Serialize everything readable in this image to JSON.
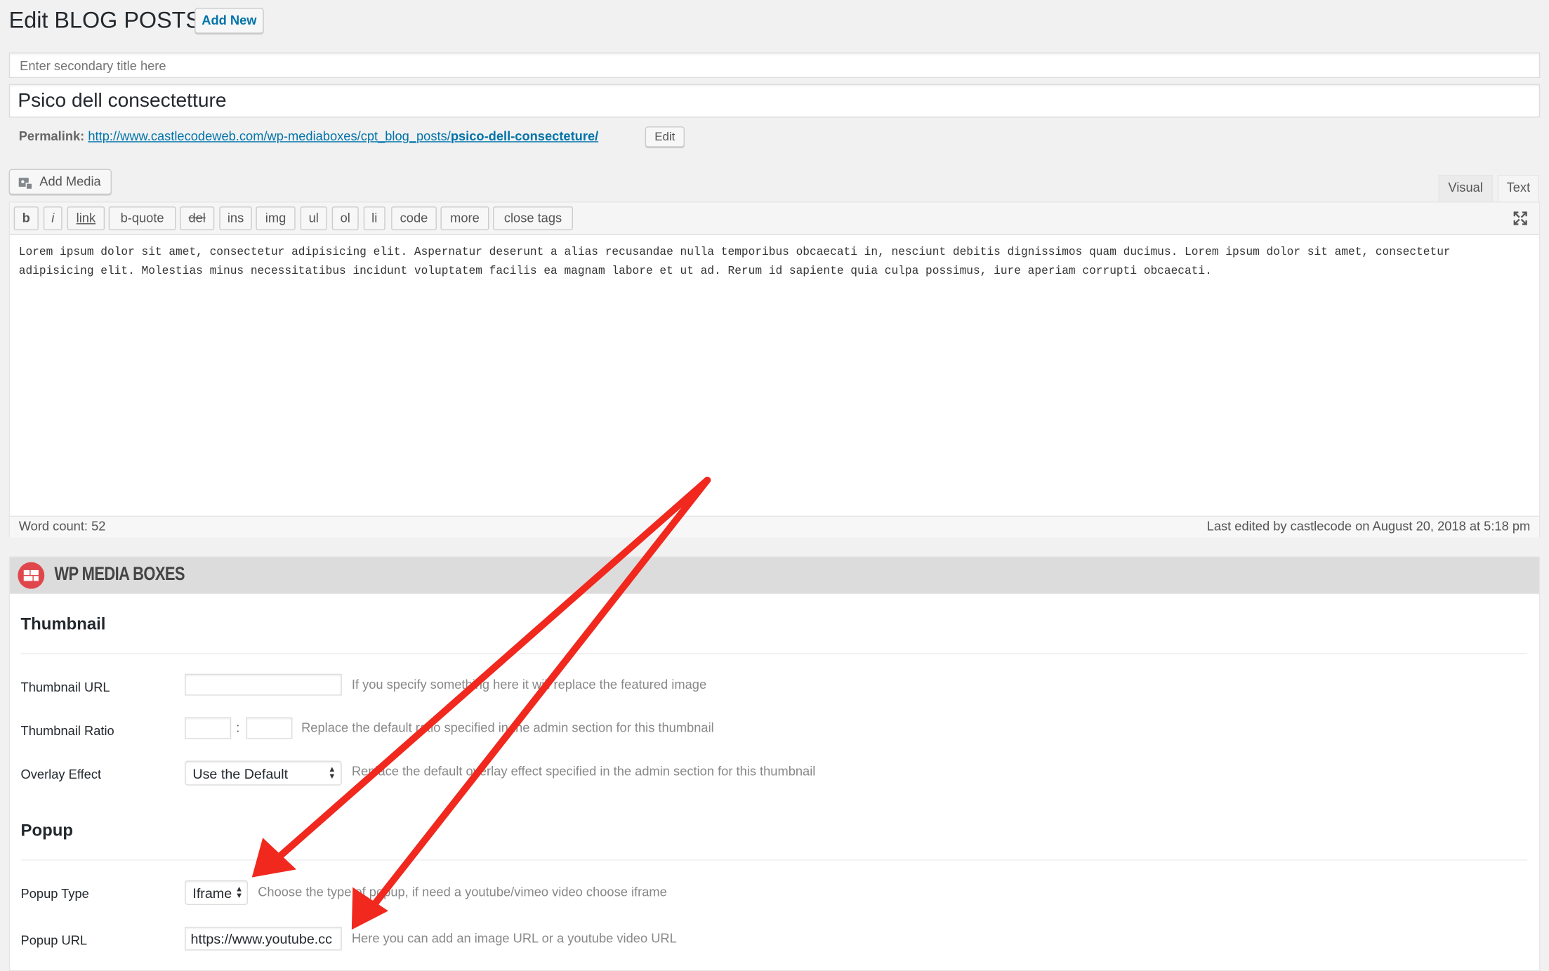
{
  "header": {
    "title": "Edit BLOG POSTS",
    "add_new": "Add New"
  },
  "secondary_title": {
    "placeholder": "Enter secondary title here",
    "value": ""
  },
  "post_title": "Psico dell consectetture",
  "permalink": {
    "label": "Permalink:",
    "url_base": "http://www.castlecodeweb.com/wp-mediaboxes/cpt_blog_posts/",
    "slug": "psico-dell-consecteture/",
    "edit": "Edit"
  },
  "editor": {
    "add_media": "Add Media",
    "tabs": [
      "Visual",
      "Text"
    ],
    "quicktags": [
      "b",
      "i",
      "link",
      "b-quote",
      "del",
      "ins",
      "img",
      "ul",
      "ol",
      "li",
      "code",
      "more",
      "close tags"
    ],
    "content": "Lorem ipsum dolor sit amet, consectetur adipisicing elit. Aspernatur deserunt a alias recusandae nulla temporibus obcaecati in, nesciunt debitis dignissimos quam ducimus. Lorem ipsum dolor sit amet, consectetur adipisicing elit. Molestias minus necessitatibus incidunt voluptatem facilis ea magnam labore et ut ad. Rerum id sapiente quia culpa possimus, iure aperiam corrupti obcaecati.",
    "word_count": "Word count: 52",
    "last_edited": "Last edited by castlecode on August 20, 2018 at 5:18 pm"
  },
  "metabox": {
    "title": "WP MEDIA BOXES",
    "thumbnail_heading": "Thumbnail",
    "thumbnail_url": {
      "label": "Thumbnail URL",
      "value": "",
      "desc": "If you specify something here it will replace the featured image"
    },
    "thumbnail_ratio": {
      "label": "Thumbnail Ratio",
      "separator": ":",
      "desc": "Replace the default ratio specified in the admin section for this thumbnail"
    },
    "overlay_effect": {
      "label": "Overlay Effect",
      "value": "Use the Default",
      "desc": "Replace the default overlay effect specified in the admin section for this thumbnail"
    },
    "popup_heading": "Popup",
    "popup_type": {
      "label": "Popup Type",
      "value": "Iframe",
      "desc": "Choose the type of popup, if need a youtube/vimeo video choose iframe"
    },
    "popup_url": {
      "label": "Popup URL",
      "value": "https://www.youtube.cc",
      "desc": "Here you can add an image URL or a youtube video URL"
    }
  },
  "colors": {
    "link": "#0073aa",
    "annotation_arrow": "#f0281e",
    "metabox_icon": "#e0474c"
  }
}
